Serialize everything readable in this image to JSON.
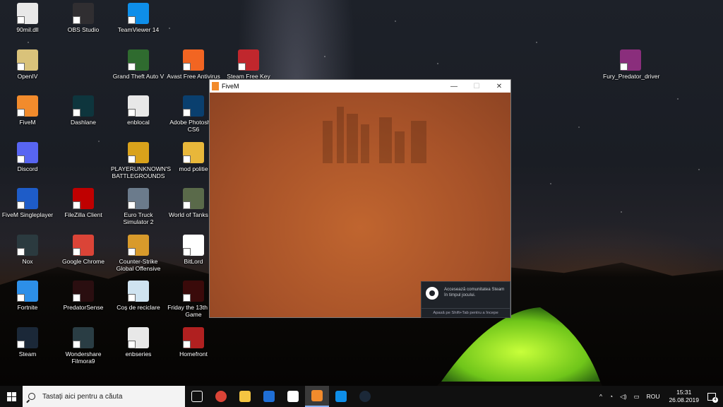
{
  "desktop": {
    "icons": [
      {
        "label": "90mil.dll",
        "icon": "file-icon",
        "color": "#e8e8e8"
      },
      {
        "label": "OBS Studio",
        "icon": "obs-icon",
        "color": "#302e31"
      },
      {
        "label": "TeamViewer 14",
        "icon": "teamviewer-icon",
        "color": "#0e8ee9"
      },
      {
        "label": "OpenIV",
        "icon": "openiv-icon",
        "color": "#d9c27a"
      },
      {
        "label": "Grand Theft Auto V",
        "icon": "gtav-icon",
        "color": "#2f6b2f"
      },
      {
        "label": "Avast Free Antivirus",
        "icon": "avast-icon",
        "color": "#f26522"
      },
      {
        "label": "Steam Free Key",
        "icon": "steam-key-icon",
        "color": "#c0272d"
      },
      {
        "label": "Fury_Predator_driver",
        "icon": "winrar-icon",
        "color": "#8a2e7c"
      },
      {
        "label": "FiveM",
        "icon": "fivem-icon",
        "color": "#f28b2c"
      },
      {
        "label": "Dashlane",
        "icon": "dashlane-icon",
        "color": "#0e353d"
      },
      {
        "label": "enblocal",
        "icon": "settings-file-icon",
        "color": "#e8e8e8"
      },
      {
        "label": "Adobe Photoshop CS6",
        "icon": "photoshop-icon",
        "color": "#0a3f6e"
      },
      {
        "label": "Discord",
        "icon": "discord-icon",
        "color": "#5865f2"
      },
      {
        "label": "PLAYERUNKNOWN'S BATTLEGROUNDS",
        "icon": "pubg-icon",
        "color": "#d9a21b"
      },
      {
        "label": "mod politie",
        "icon": "folder-icon",
        "color": "#e8b73a"
      },
      {
        "label": "FiveM Singleplayer",
        "icon": "fivem-sp-icon",
        "color": "#1e5cc8"
      },
      {
        "label": "FileZilla Client",
        "icon": "filezilla-icon",
        "color": "#bf0000"
      },
      {
        "label": "Euro Truck Simulator 2",
        "icon": "ets2-icon",
        "color": "#6b7b8c"
      },
      {
        "label": "World of Tanks EU",
        "icon": "wot-icon",
        "color": "#5a6a4a"
      },
      {
        "label": "Nox",
        "icon": "nox-icon",
        "color": "#2b3a3f"
      },
      {
        "label": "Google Chrome",
        "icon": "chrome-icon",
        "color": "#db4437"
      },
      {
        "label": "Counter-Strike Global Offensive",
        "icon": "csgo-icon",
        "color": "#d89a2b"
      },
      {
        "label": "BitLord",
        "icon": "bitlord-icon",
        "color": "#ffffff"
      },
      {
        "label": "Fortnite",
        "icon": "fortnite-icon",
        "color": "#2d8fe8"
      },
      {
        "label": "PredatorSense",
        "icon": "predator-icon",
        "color": "#2a0e10"
      },
      {
        "label": "Coș de reciclare",
        "icon": "recycle-bin-icon",
        "color": "#cfe3f0"
      },
      {
        "label": "Friday the 13th The Game",
        "icon": "friday13-icon",
        "color": "#3a0a0a"
      },
      {
        "label": "Steam",
        "icon": "steam-icon",
        "color": "#1b2838"
      },
      {
        "label": "Wondershare Filmora9",
        "icon": "filmora-icon",
        "color": "#2a3d44"
      },
      {
        "label": "enbseries",
        "icon": "settings-file-icon",
        "color": "#e8e8e8"
      },
      {
        "label": "Homefront",
        "icon": "homefront-icon",
        "color": "#b02020"
      }
    ]
  },
  "window": {
    "title": "FiveM",
    "minimize": "—",
    "maximize": "☐",
    "close": "✕"
  },
  "steam_overlay": {
    "message": "Accesează comunitatea Steam în timpul jocului.",
    "hint": "Apasă pe Shift+Tab pentru a începe"
  },
  "taskbar": {
    "search_placeholder": "Tastați aici pentru a căuta",
    "apps": [
      {
        "name": "task-view",
        "color": "#101010"
      },
      {
        "name": "chrome",
        "color": "#db4437"
      },
      {
        "name": "file-explorer",
        "color": "#f4c542"
      },
      {
        "name": "microsoft-store",
        "color": "#1f6fd6"
      },
      {
        "name": "mail",
        "color": "#ffffff"
      },
      {
        "name": "fivem",
        "color": "#f28b2c"
      },
      {
        "name": "teamviewer",
        "color": "#0e8ee9"
      },
      {
        "name": "steam",
        "color": "#1b2838"
      }
    ],
    "tray": {
      "language": "ROU",
      "time": "15:31",
      "date": "26.08.2019",
      "notifications": "4"
    }
  },
  "colors": {
    "accent": "#f28b2c",
    "game_bg": "#b25a2b"
  }
}
